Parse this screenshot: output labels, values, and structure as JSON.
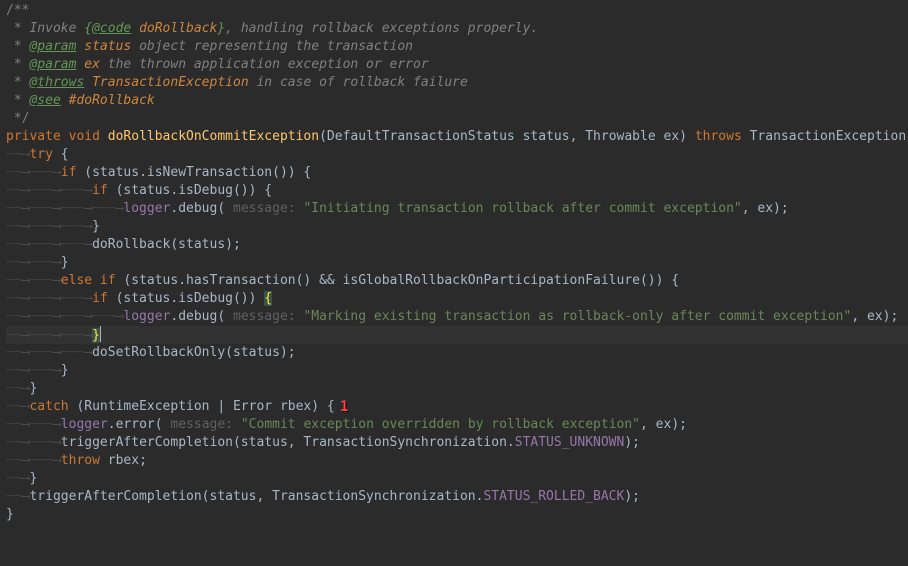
{
  "javadoc": {
    "open": "/**",
    "line1_prefix": " * Invoke ",
    "line1_code_open": "{",
    "line1_code_tag": "@code",
    "line1_code_val": " doRollback",
    "line1_code_close": "}",
    "line1_suffix": ", handling rollback exceptions properly.",
    "param1_bullet": " * ",
    "param1_tag": "@param",
    "param1_name": " status",
    "param1_desc": " object representing the transaction",
    "param2_bullet": " * ",
    "param2_tag": "@param",
    "param2_name": " ex",
    "param2_desc": " the thrown application exception or error",
    "throws_bullet": " * ",
    "throws_tag": "@throws",
    "throws_name": " TransactionException",
    "throws_desc": " in case of rollback failure",
    "see_bullet": " * ",
    "see_tag": "@see",
    "see_target": " #doRollback",
    "close": " */"
  },
  "sig": {
    "private": "private",
    "void": " void ",
    "name": "doRollbackOnCommitException",
    "open": "(",
    "p1type": "DefaultTransactionStatus ",
    "p1name": "status",
    "comma": ", ",
    "p2type": "Throwable ",
    "p2name": "ex",
    "close": ") ",
    "throws": "throws",
    "exc": " TransactionException {"
  },
  "body": {
    "try": "try",
    "try_open": " {",
    "if1": "if",
    "if1_cond": " (status.isNewTransaction()) {",
    "if2": "if",
    "if2_cond": " (status.isDebug()) {",
    "log1_obj": "logger",
    "log1_dot": ".",
    "log1_m": "debug( ",
    "log1_hint": "message: ",
    "log1_str": "\"Initiating transaction rollback after commit exception\"",
    "log1_tail": ", ex);",
    "close_brace": "}",
    "doRollback": "doRollback(status);",
    "elseif": "else if",
    "elseif_cond": " (status.hasTransaction() && isGlobalRollbackOnParticipationFailure()) {",
    "if3": "if",
    "if3_cond": " (status.isDebug()) ",
    "if3_brace": "{",
    "log2_obj": "logger",
    "log2_dot": ".",
    "log2_m": "debug( ",
    "log2_hint": "message: ",
    "log2_str": "\"Marking existing transaction as rollback-only after commit exception\"",
    "log2_tail": ", ex);",
    "close_brace_hi": "}",
    "doSetRollback": "doSetRollbackOnly(status);",
    "catch": "catch",
    "catch_cond": " (RuntimeException | Error rbex) {",
    "loge_obj": "logger",
    "loge_dot": ".",
    "loge_m": "error( ",
    "loge_hint": "message: ",
    "loge_str": "\"Commit exception overridden by rollback exception\"",
    "loge_tail": ", ex);",
    "trig1_a": "triggerAfterCompletion(status, TransactionSynchronization.",
    "trig1_c": "STATUS_UNKNOWN",
    "trig1_b": ");",
    "throw": "throw",
    "throw_tail": " rbex;",
    "trig2_a": "triggerAfterCompletion(status, TransactionSynchronization.",
    "trig2_c": "STATUS_ROLLED_BACK",
    "trig2_b": ");"
  },
  "fold": {
    "i0": "",
    "g1": "┈┈⟶",
    "g2": "┈┈⟶┈┈┈⟶",
    "g3": "┈┈⟶┈┈┈⟶┈┈┈⟶",
    "g4": "┈┈⟶┈┈┈⟶┈┈┈⟶┈┈┈⟶",
    "g5": "┈┈⟶┈┈┈⟶┈┈┈⟶┈┈┈⟶┈┈┈⟶"
  },
  "marker": "1"
}
